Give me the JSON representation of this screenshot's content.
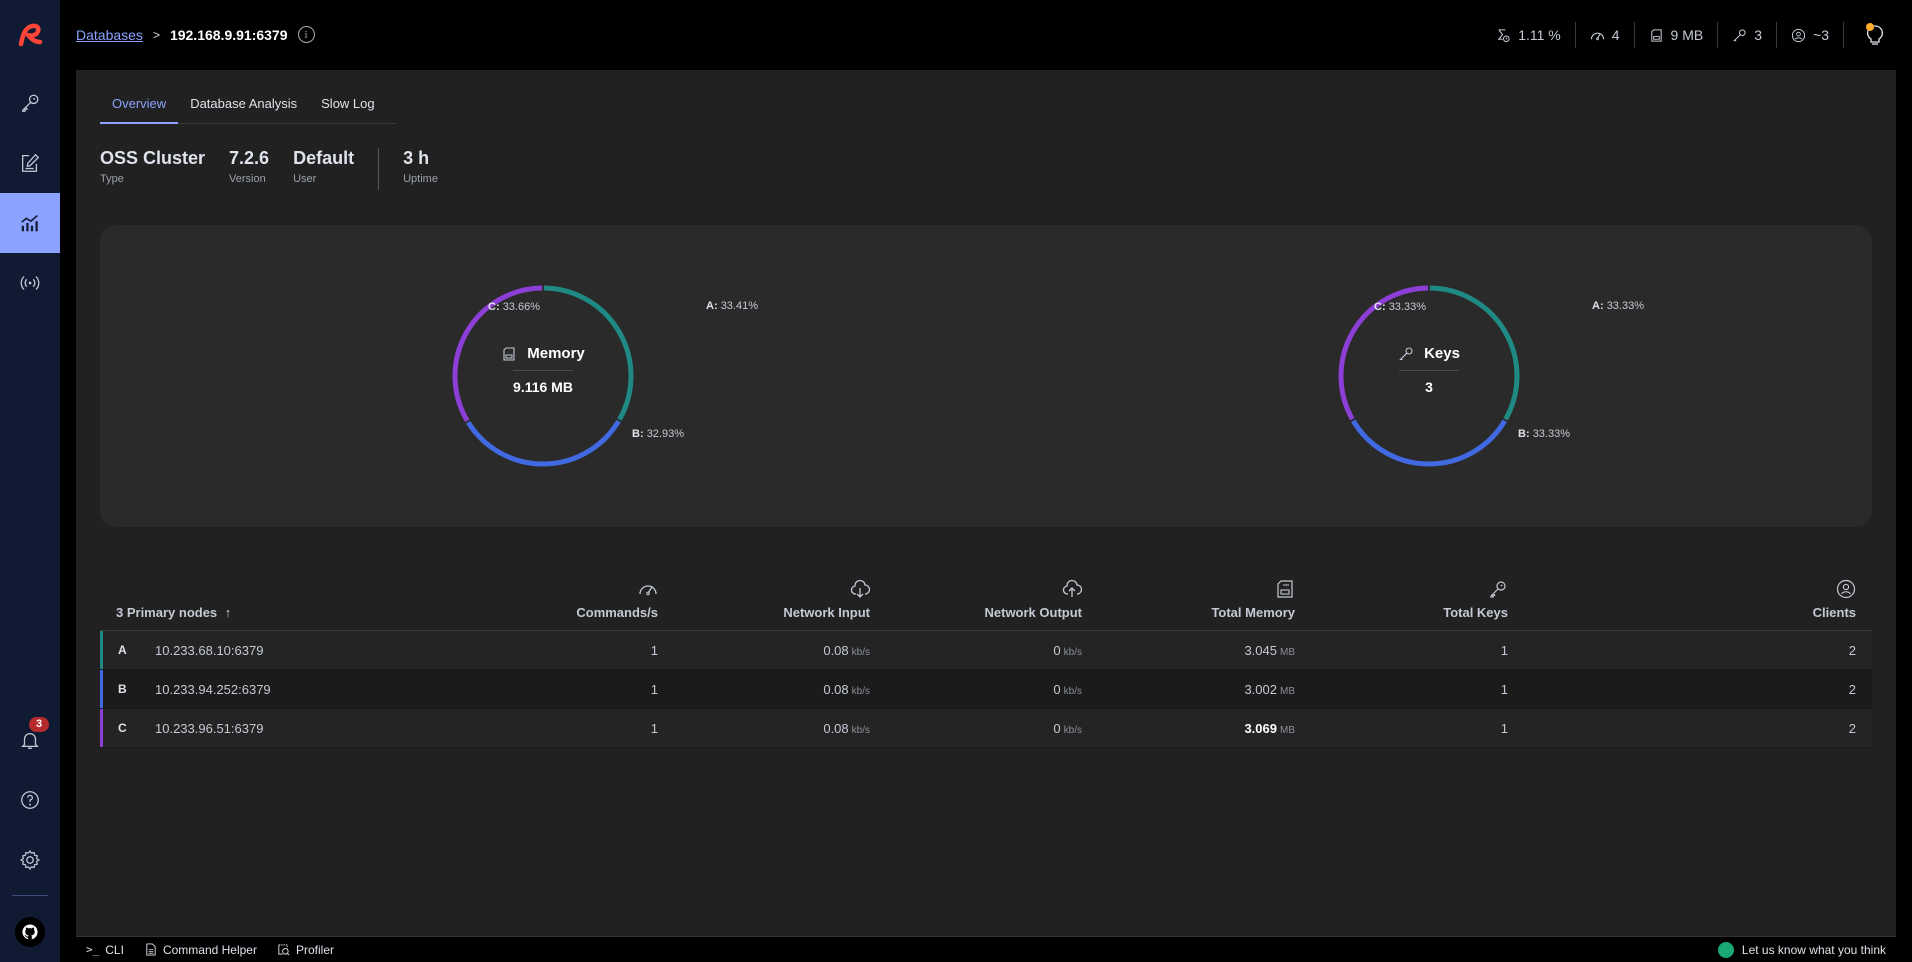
{
  "nav": {
    "items": [
      {
        "name": "browser",
        "icon": "key-icon",
        "active": false
      },
      {
        "name": "workbench",
        "icon": "edit-icon",
        "active": false
      },
      {
        "name": "analytics",
        "icon": "analytics-icon",
        "active": true
      },
      {
        "name": "pubsub",
        "icon": "broadcast-icon",
        "active": false
      }
    ],
    "bottom_items": [
      {
        "name": "notifications",
        "icon": "bell-icon",
        "badge": "3"
      },
      {
        "name": "help",
        "icon": "help-icon"
      },
      {
        "name": "settings",
        "icon": "gear-icon"
      }
    ]
  },
  "header": {
    "breadcrumb_link": "Databases",
    "breadcrumb_sep": ">",
    "host": "192.168.9.91:6379",
    "stats": {
      "cpu": "1.11 %",
      "ops": "4",
      "memory": "9 MB",
      "keys": "3",
      "clients": "~3"
    }
  },
  "tabs": [
    {
      "label": "Overview",
      "active": true
    },
    {
      "label": "Database Analysis",
      "active": false
    },
    {
      "label": "Slow Log",
      "active": false
    }
  ],
  "info": {
    "type": {
      "value": "OSS Cluster",
      "label": "Type"
    },
    "version": {
      "value": "7.2.6",
      "label": "Version"
    },
    "user": {
      "value": "Default",
      "label": "User"
    },
    "uptime": {
      "value": "3 h",
      "label": "Uptime"
    }
  },
  "colors": {
    "A": "#1f8a84",
    "B": "#4169e1",
    "C": "#8d3ed6",
    "accent": "#8ba2ff"
  },
  "chart_data": [
    {
      "type": "pie",
      "title": "Memory",
      "total": "9.116 MB",
      "categories": [
        "A",
        "B",
        "C"
      ],
      "values": [
        33.41,
        32.93,
        33.66
      ],
      "labels": [
        "33.41%",
        "32.93%",
        "33.66%"
      ]
    },
    {
      "type": "pie",
      "title": "Keys",
      "total": "3",
      "categories": [
        "A",
        "B",
        "C"
      ],
      "values": [
        33.33,
        33.33,
        33.33
      ],
      "labels": [
        "33.33%",
        "33.33%",
        "33.33%"
      ]
    }
  ],
  "table": {
    "title": "3 Primary nodes",
    "sort_indicator": "↑",
    "columns": [
      "Commands/s",
      "Network Input",
      "Network Output",
      "Total Memory",
      "Total Keys",
      "Clients"
    ],
    "rows": [
      {
        "letter": "A",
        "address": "10.233.68.10:6379",
        "commands": "1",
        "net_in": "0.08",
        "net_in_unit": "kb/s",
        "net_out": "0",
        "net_out_unit": "kb/s",
        "memory": "3.045",
        "memory_unit": "MB",
        "keys": "1",
        "clients": "2"
      },
      {
        "letter": "B",
        "address": "10.233.94.252:6379",
        "commands": "1",
        "net_in": "0.08",
        "net_in_unit": "kb/s",
        "net_out": "0",
        "net_out_unit": "kb/s",
        "memory": "3.002",
        "memory_unit": "MB",
        "keys": "1",
        "clients": "2"
      },
      {
        "letter": "C",
        "address": "10.233.96.51:6379",
        "commands": "1",
        "net_in": "0.08",
        "net_in_unit": "kb/s",
        "net_out": "0",
        "net_out_unit": "kb/s",
        "memory": "3.069",
        "memory_unit": "MB",
        "keys": "1",
        "clients": "2"
      }
    ]
  },
  "bottom_bar": {
    "cli": "CLI",
    "command_helper": "Command Helper",
    "profiler": "Profiler",
    "feedback": "Let us know what you think"
  }
}
